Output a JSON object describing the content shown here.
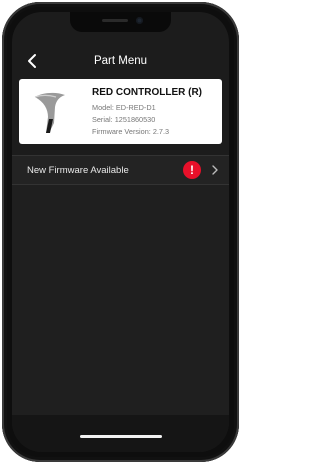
{
  "header": {
    "title": "Part Menu",
    "back_icon": "chevron-left-icon"
  },
  "part": {
    "name": "RED CONTROLLER (R)",
    "model": "Model: ED-RED-D1",
    "serial": "Serial: 1251860530",
    "firmware": "Firmware Version: 2.7.3",
    "image_icon": "controller-lever-icon"
  },
  "firmware_row": {
    "label": "New Firmware Available",
    "badge": "!",
    "badge_color": "#e8102a",
    "chevron_icon": "chevron-right-icon"
  },
  "colors": {
    "background": "#1c1c1c",
    "card": "#ffffff",
    "accent_alert": "#e8102a"
  }
}
